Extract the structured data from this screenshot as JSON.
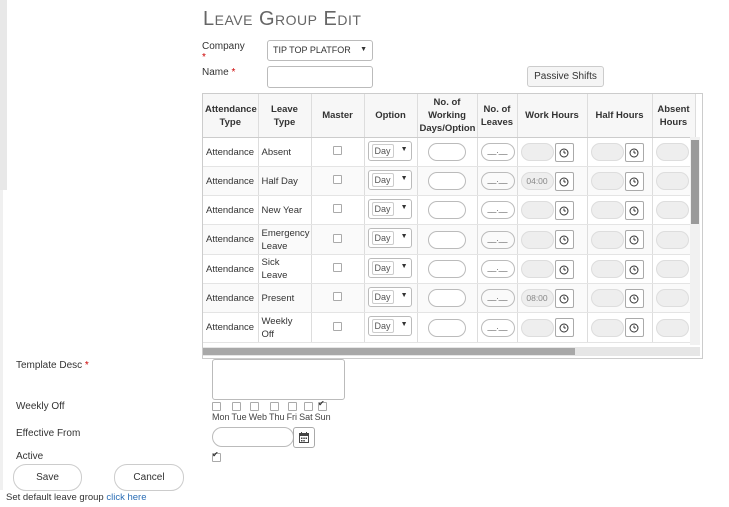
{
  "page": {
    "title": "Leave Group Edit"
  },
  "form": {
    "company_label": "Company",
    "company_required": "*",
    "company_value": "TIP TOP PLATFOR",
    "name_label": "Name",
    "name_required": "*",
    "name_value": "",
    "passive_shifts_label": "Passive Shifts"
  },
  "grid": {
    "columns": [
      "Attendance Type",
      "Leave Type",
      "Master",
      "Option",
      "No. of Working Days/Option",
      "No. of Leaves",
      "Work Hours",
      "Half Hours",
      "Absent Hours"
    ],
    "rows": [
      {
        "attendance": "Attendance",
        "leave": "Absent",
        "option": "Day",
        "leaves": "__.__",
        "work_hours": "",
        "half_hours": "",
        "absent_hours": ""
      },
      {
        "attendance": "Attendance",
        "leave": "Half Day",
        "option": "Day",
        "leaves": "__.__",
        "work_hours": "04:00",
        "half_hours": "",
        "absent_hours": ""
      },
      {
        "attendance": "Attendance",
        "leave": "New Year",
        "option": "Day",
        "leaves": "__.__",
        "work_hours": "",
        "half_hours": "",
        "absent_hours": ""
      },
      {
        "attendance": "Attendance",
        "leave": "Emergency Leave",
        "option": "Day",
        "leaves": "__.__",
        "work_hours": "",
        "half_hours": "",
        "absent_hours": ""
      },
      {
        "attendance": "Attendance",
        "leave": "Sick Leave",
        "option": "Day",
        "leaves": "__.__",
        "work_hours": "",
        "half_hours": "",
        "absent_hours": ""
      },
      {
        "attendance": "Attendance",
        "leave": "Present",
        "option": "Day",
        "leaves": "__.__",
        "work_hours": "08:00",
        "half_hours": "",
        "absent_hours": ""
      },
      {
        "attendance": "Attendance",
        "leave": "Weekly Off",
        "option": "Day",
        "leaves": "__.__",
        "work_hours": "",
        "half_hours": "",
        "absent_hours": ""
      }
    ]
  },
  "lower": {
    "template_desc_label": "Template Desc",
    "template_desc_required": "*",
    "weekly_off_label": "Weekly Off",
    "days": [
      "Mon",
      "Tue",
      "Web",
      "Thu",
      "Fri",
      "Sat",
      "Sun"
    ],
    "days_checked": [
      false,
      false,
      false,
      false,
      false,
      false,
      true
    ],
    "effective_from_label": "Effective From",
    "active_label": "Active",
    "active_checked": true,
    "save_label": "Save",
    "cancel_label": "Cancel",
    "footer_text": "Set default leave group",
    "footer_link": "click here"
  },
  "icons": {
    "clock": "clock-icon",
    "calendar": "calendar-icon",
    "caret": "chevron-down-icon"
  }
}
